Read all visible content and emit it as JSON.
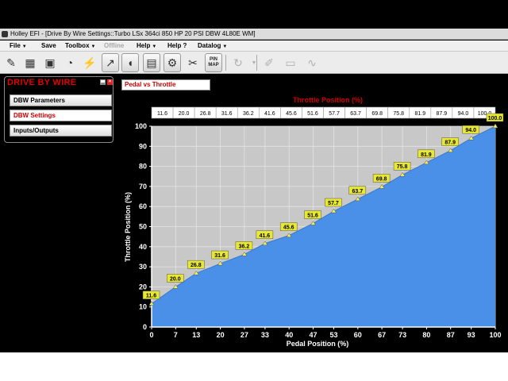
{
  "window": {
    "title": "Holley EFI - [Drive By Wire Settings::Turbo LSx 364ci 850 HP 20 PSI DBW 4L80E WM]"
  },
  "menu": {
    "file": "File",
    "save": "Save",
    "toolbox": "Toolbox",
    "offline": "Offline",
    "help": "Help",
    "help_q": "Help ?",
    "datalog": "Datalog"
  },
  "toolbar": {
    "icons": [
      "injector-icon",
      "ecu-icon",
      "harness-icon",
      "gauge-icon",
      "spark-plug-icon",
      "table-icon",
      "fuel-icon",
      "sensors-icon",
      "tools-icon",
      "pin-map-icon",
      "refresh-icon",
      "settings-icon",
      "tape-icon",
      "waveform-icon"
    ],
    "pin_map_label": "PIN MAP"
  },
  "sidebar": {
    "title": "DRIVE BY WIRE",
    "items": [
      {
        "label": "DBW Parameters",
        "active": false
      },
      {
        "label": "DBW Settings",
        "active": true
      },
      {
        "label": "Inputs/Outputs",
        "active": false
      }
    ]
  },
  "content": {
    "tab_label": "Pedal vs Throttle"
  },
  "chart_data": {
    "type": "area",
    "title": "Throttle Position (%)",
    "xlabel": "Pedal Position (%)",
    "ylabel": "Throttle Position (%)",
    "x": [
      0,
      7,
      13,
      20,
      27,
      33,
      40,
      47,
      53,
      60,
      67,
      73,
      80,
      87,
      93,
      100
    ],
    "x_tick_labels": [
      "0",
      "7",
      "13",
      "20",
      "27",
      "33",
      "40",
      "47",
      "53",
      "60",
      "67",
      "73",
      "80",
      "87",
      "93",
      "100"
    ],
    "values": [
      11.6,
      20.0,
      26.8,
      31.6,
      36.2,
      41.6,
      45.6,
      51.6,
      57.7,
      63.7,
      69.8,
      75.8,
      81.9,
      87.9,
      94.0,
      100.0
    ],
    "value_labels": [
      "11.6",
      "20.0",
      "26.8",
      "31.6",
      "36.2",
      "41.6",
      "45.6",
      "51.6",
      "57.7",
      "63.7",
      "69.8",
      "75.8",
      "81.9",
      "87.9",
      "94.0",
      "100.0"
    ],
    "y_ticks": [
      "0",
      "10",
      "20",
      "30",
      "40",
      "50",
      "60",
      "70",
      "80",
      "90",
      "100"
    ],
    "ylim": [
      0,
      100
    ],
    "xlim": [
      0,
      100
    ],
    "grid": true,
    "colors": {
      "fill": "#4a90e8",
      "plot_bg": "#c8c8c8",
      "label_bg": "#e8e830",
      "title": "#d00000"
    }
  }
}
